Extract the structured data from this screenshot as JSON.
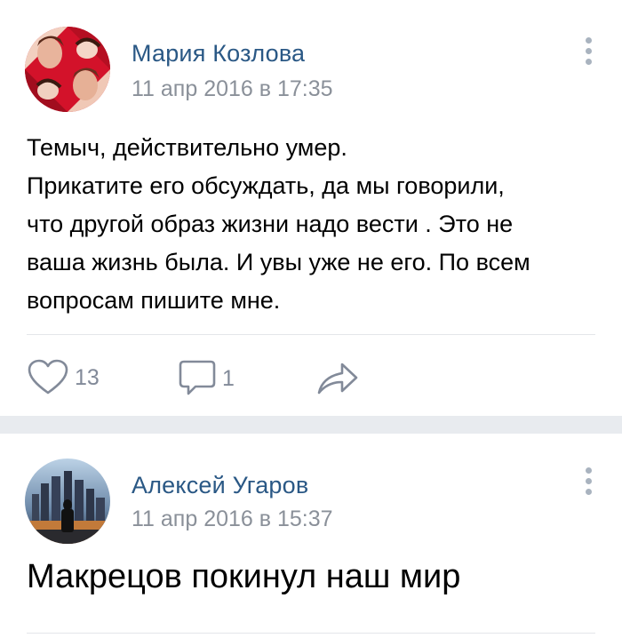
{
  "posts": [
    {
      "author": "Мария Козлова",
      "time": "11 апр 2016 в 17:35",
      "lines": [
        "Темыч, действительно умер.",
        "Прикатите его обсуждать, да мы говорили,",
        "что другой образ жизни надо вести . Это не",
        "ваша жизнь была. И увы уже не его. По всем",
        "вопросам пишите мне."
      ],
      "likes": "13",
      "comments": "1",
      "icons": {
        "like": "heart-icon",
        "comment": "comment-icon",
        "share": "share-icon",
        "menu": "more-vertical-icon"
      }
    },
    {
      "author": "Алексей Угаров",
      "time": "11 апр 2016 в 15:37",
      "text": "Макрецов покинул наш мир",
      "icons": {
        "menu": "more-vertical-icon"
      }
    }
  ],
  "colors": {
    "author_link": "#2a5885",
    "secondary": "#828a99",
    "feed_background": "#e8ebef"
  }
}
